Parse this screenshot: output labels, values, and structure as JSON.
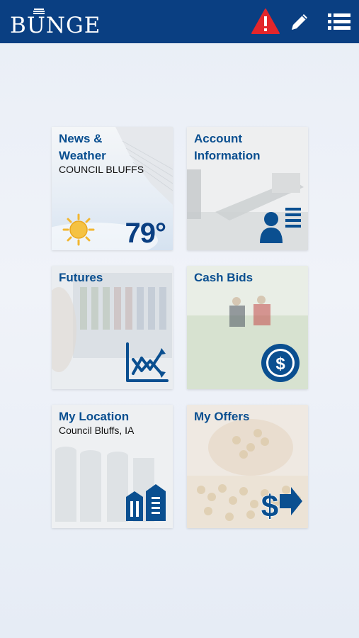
{
  "header": {
    "logo_text": "BUNGE",
    "icons": [
      "alert-triangle-icon",
      "pencil-icon",
      "list-icon"
    ],
    "bg_color": "#0a3f82",
    "alert_color": "#e3262b"
  },
  "tiles": {
    "news": {
      "title_line1": "News &",
      "title_line2": "Weather",
      "location": "COUNCIL BLUFFS",
      "temperature": "79°",
      "icon": "sun-icon"
    },
    "account": {
      "title_line1": "Account",
      "title_line2": "Information",
      "icon": "account-list-icon"
    },
    "futures": {
      "title": "Futures",
      "icon": "futures-chart-icon"
    },
    "cash_bids": {
      "title": "Cash Bids",
      "icon": "dollar-coin-icon"
    },
    "location": {
      "title": "My Location",
      "subtitle": "Council Bluffs, IA",
      "icon": "grain-elevator-icon"
    },
    "offers": {
      "title": "My Offers",
      "icon": "dollar-arrow-icon"
    }
  },
  "colors": {
    "accent": "#0a4f90",
    "sun": "#f5c242"
  }
}
